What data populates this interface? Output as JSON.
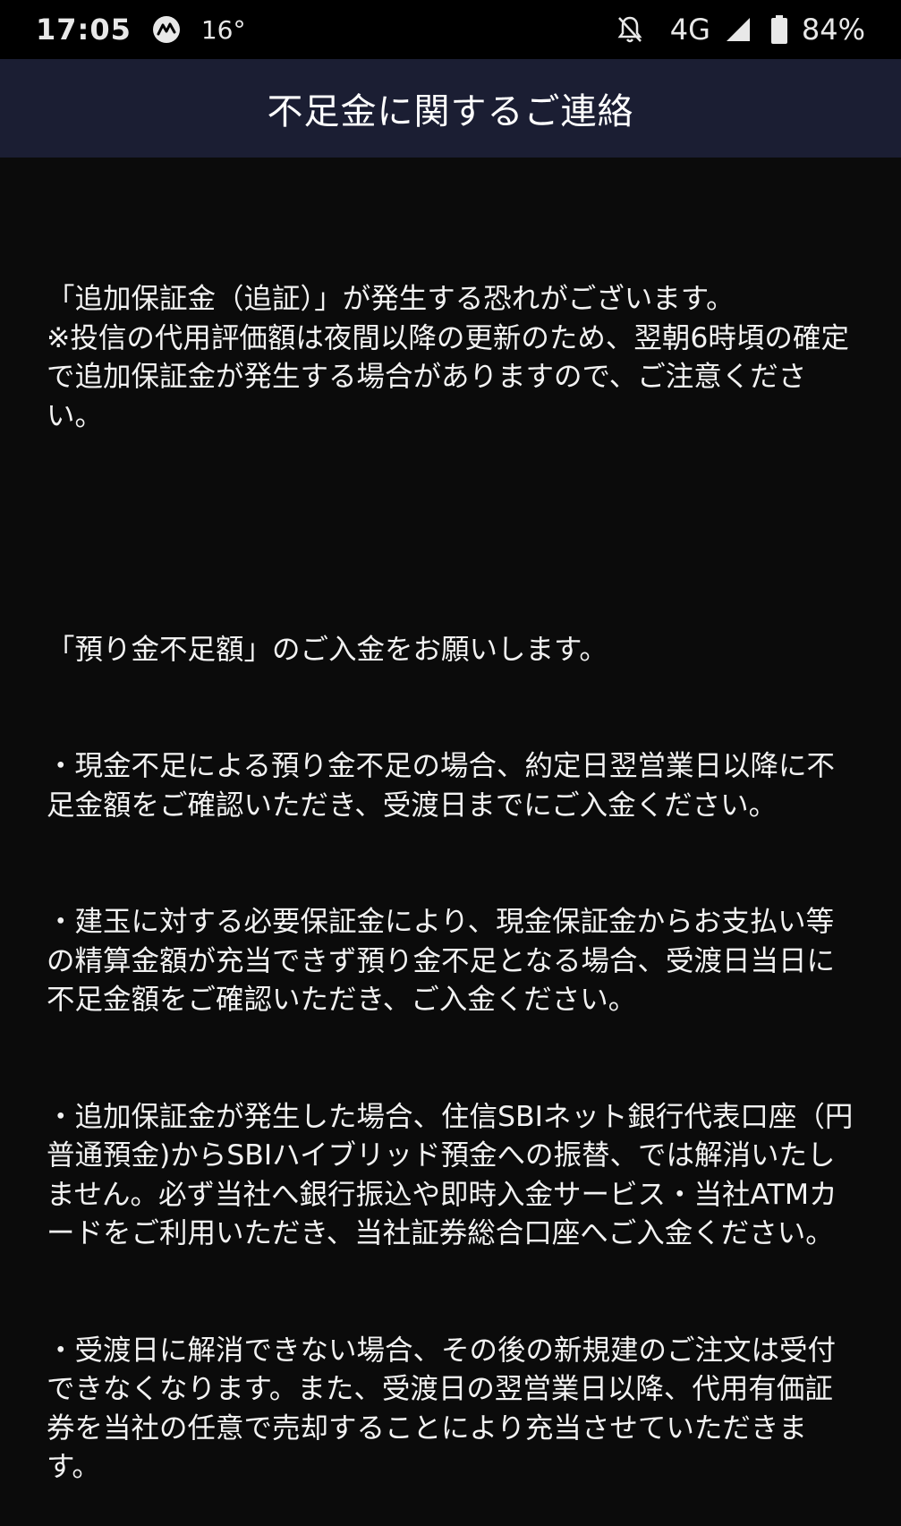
{
  "status_bar": {
    "time": "17:05",
    "temperature": "16°",
    "network": "4G",
    "battery": "84%",
    "icons": [
      "app-notification-icon",
      "notifications-off-icon",
      "signal-icon",
      "battery-icon"
    ]
  },
  "header": {
    "title": "不足金に関するご連絡"
  },
  "message": {
    "p1": "「追加保証金（追証）」が発生する恐れがございます。\n※投信の代用評価額は夜間以降の更新のため、翌朝6時頃の確定で追加保証金が発生する場合がありますので、ご注意ください。",
    "p2": "「預り金不足額」のご入金をお願いします。",
    "b1": "・現金不足による預り金不足の場合、約定日翌営業日以降に不足金額をご確認いただき、受渡日までにご入金ください。",
    "b2": "・建玉に対する必要保証金により、現金保証金からお支払い等の精算金額が充当できず預り金不足となる場合、受渡日当日に不足金額をご確認いただき、ご入金ください。",
    "b3": "・追加保証金が発生した場合、住信SBIネット銀行代表口座（円普通預金)からSBIハイブリッド預金への振替、では解消いたしません。必ず当社へ銀行振込や即時入金サービス・当社ATMカードをご利用いただき、当社証券総合口座へご入金ください。",
    "b4": "・受渡日に解消できない場合、その後の新規建のご注文は受付できなくなります。また、受渡日の翌営業日以降、代用有価証券を当社の任意で売却することにより充当させていただきます。"
  },
  "colors": {
    "background": "#0b0b0b",
    "header_bg": "#1b1e33",
    "status_bg": "#000000",
    "text": "#f2f2f2"
  }
}
